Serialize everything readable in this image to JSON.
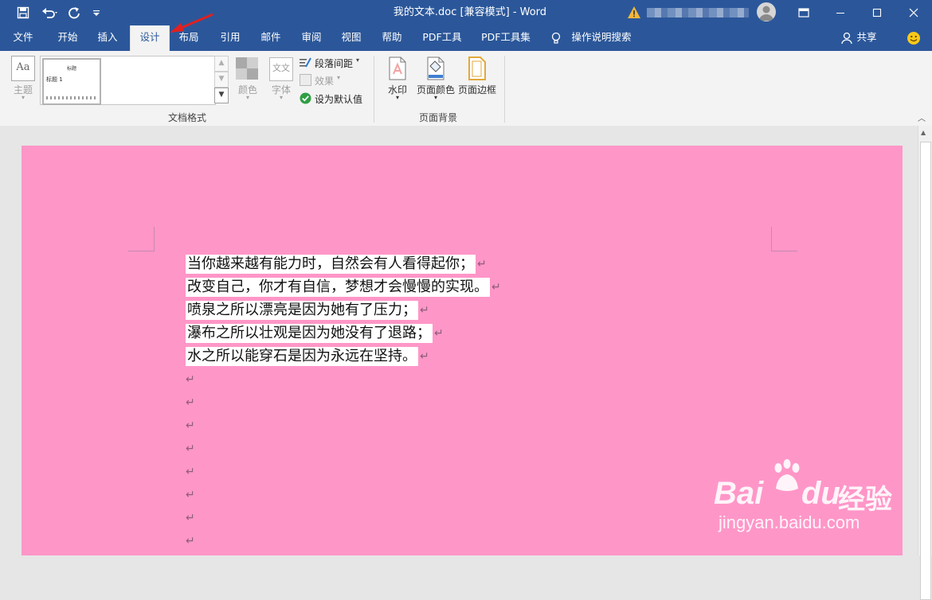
{
  "window": {
    "title": "我的文本.doc [兼容模式]  -  Word"
  },
  "qat": {
    "save_icon": "save-icon",
    "undo_icon": "undo-icon",
    "redo_icon": "redo-icon",
    "customize_icon": "chevron-down-icon"
  },
  "tabs": [
    {
      "label": "文件"
    },
    {
      "label": "开始"
    },
    {
      "label": "插入"
    },
    {
      "label": "设计"
    },
    {
      "label": "布局"
    },
    {
      "label": "引用"
    },
    {
      "label": "邮件"
    },
    {
      "label": "审阅"
    },
    {
      "label": "视图"
    },
    {
      "label": "帮助"
    },
    {
      "label": "PDF工具"
    },
    {
      "label": "PDF工具集"
    }
  ],
  "active_tab": "设计",
  "tell_me": "操作说明搜索",
  "share": "共享",
  "ribbon": {
    "doc_format": {
      "themes": "主题",
      "style_title": "标题",
      "style_heading": "标题 1",
      "colors": "颜色",
      "fonts": "字体",
      "fonts_icon_text": "文文",
      "paragraph_spacing": "段落间距",
      "effects": "效果",
      "set_default": "设为默认值",
      "group_label": "文档格式"
    },
    "page_background": {
      "watermark": "水印",
      "page_color": "页面颜色",
      "page_borders": "页面边框",
      "group_label": "页面背景"
    }
  },
  "document": {
    "page_color": "#ff96c8",
    "lines": [
      "当你越来越有能力时，自然会有人看得起你；",
      "改变自己，你才有自信，梦想才会慢慢的实现。",
      "喷泉之所以漂亮是因为她有了压力；",
      "瀑布之所以壮观是因为她没有了退路；",
      "水之所以能穿石是因为永远在坚持。"
    ],
    "paragraph_mark": "↵"
  },
  "watermark": {
    "brand": "Bai",
    "brand2": "du",
    "brand_cn": "经验",
    "url": "jingyan.baidu.com"
  },
  "colors": {
    "titlebar": "#2b579a",
    "ribbon": "#f3f3f3",
    "page": "#ff96c8"
  }
}
